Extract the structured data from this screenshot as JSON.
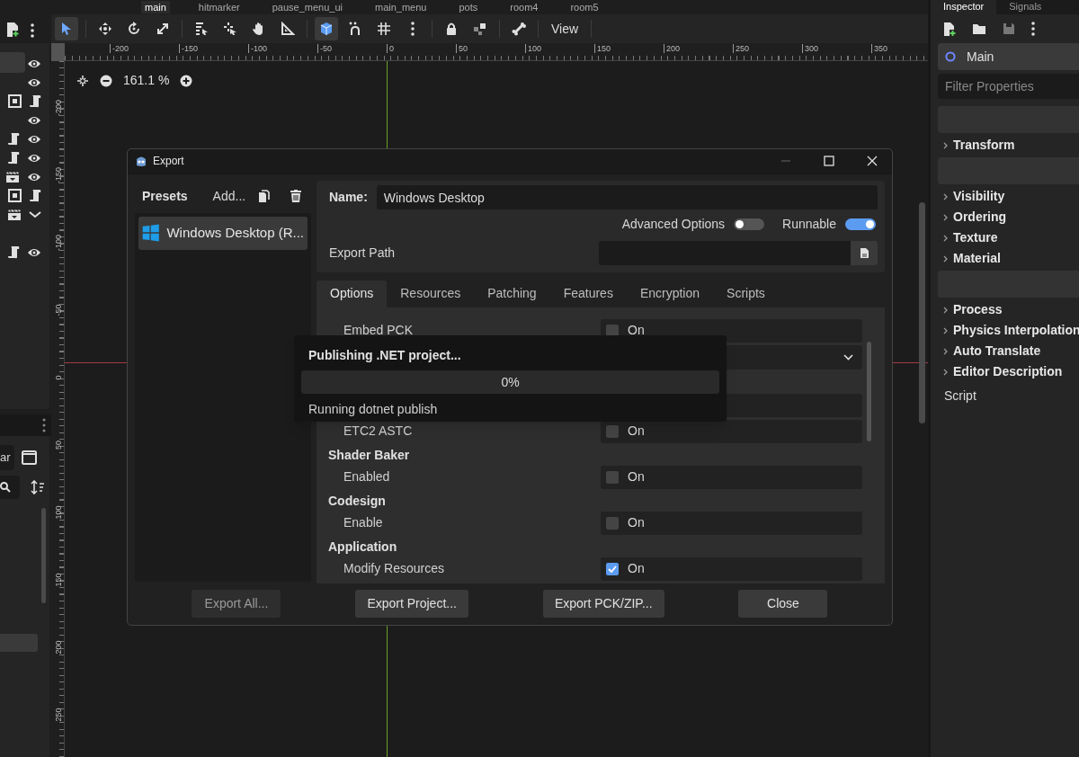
{
  "scene_tabs": [
    {
      "label": "main",
      "selected": true
    },
    {
      "label": "hitmarker",
      "selected": false
    },
    {
      "label": "pause_menu_ui",
      "selected": false
    },
    {
      "label": "main_menu",
      "selected": false
    },
    {
      "label": "pots",
      "selected": false
    },
    {
      "label": "room4",
      "selected": false
    },
    {
      "label": "room5",
      "selected": false
    }
  ],
  "toolbar": {
    "view_menu": "View"
  },
  "zoom": {
    "reading": "161.1 %"
  },
  "ruler": {
    "x_labels": [
      "-200",
      "-150",
      "-100",
      "-50",
      "0",
      "50",
      "100",
      "150",
      "200",
      "250",
      "300",
      "350"
    ],
    "y_labels": [
      "-200",
      "-150",
      "-100",
      "-50",
      "0",
      "50",
      "100",
      "150",
      "200",
      "250"
    ]
  },
  "filesystem": {
    "filter_value": "ar"
  },
  "inspector": {
    "tabs": [
      {
        "label": "Inspector",
        "selected": true
      },
      {
        "label": "Signals",
        "selected": false
      }
    ],
    "node": "Main",
    "filter_placeholder": "Filter Properties",
    "items": [
      {
        "kind": "category"
      },
      {
        "kind": "section",
        "label": "Transform"
      },
      {
        "kind": "category"
      },
      {
        "kind": "section",
        "label": "Visibility"
      },
      {
        "kind": "section",
        "label": "Ordering"
      },
      {
        "kind": "section",
        "label": "Texture"
      },
      {
        "kind": "section",
        "label": "Material"
      },
      {
        "kind": "category"
      },
      {
        "kind": "section",
        "label": "Process"
      },
      {
        "kind": "section",
        "label": "Physics Interpolation"
      },
      {
        "kind": "section",
        "label": "Auto Translate"
      },
      {
        "kind": "section",
        "label": "Editor Description"
      },
      {
        "kind": "plain",
        "label": "Script"
      }
    ]
  },
  "export_dialog": {
    "title": "Export",
    "presets_label": "Presets",
    "add_label": "Add...",
    "presets": [
      {
        "label": "Windows Desktop (R...",
        "selected": true
      }
    ],
    "name_label": "Name:",
    "name_value": "Windows Desktop",
    "advanced": {
      "label": "Advanced Options",
      "on": false
    },
    "runnable": {
      "label": "Runnable",
      "on": true
    },
    "export_path_label": "Export Path",
    "tabs": [
      {
        "label": "Options",
        "selected": true
      },
      {
        "label": "Resources",
        "selected": false
      },
      {
        "label": "Patching",
        "selected": false
      },
      {
        "label": "Features",
        "selected": false
      },
      {
        "label": "Encryption",
        "selected": false
      },
      {
        "label": "Scripts",
        "selected": false
      }
    ],
    "options": [
      {
        "kind": "check",
        "label": "Embed PCK",
        "checked": false,
        "value": "On"
      },
      {
        "kind": "dropdown"
      },
      {
        "kind": "field"
      },
      {
        "kind": "check",
        "label": "ETC2 ASTC",
        "checked": false,
        "value": "On"
      },
      {
        "kind": "heading",
        "label": "Shader Baker"
      },
      {
        "kind": "check",
        "label": "Enabled",
        "checked": false,
        "value": "On"
      },
      {
        "kind": "heading",
        "label": "Codesign"
      },
      {
        "kind": "check",
        "label": "Enable",
        "checked": false,
        "value": "On"
      },
      {
        "kind": "heading",
        "label": "Application"
      },
      {
        "kind": "check",
        "label": "Modify Resources",
        "checked": true,
        "value": "On"
      }
    ],
    "buttons": [
      {
        "label": "Export All...",
        "disabled": true
      },
      {
        "label": "Export Project...",
        "disabled": false
      },
      {
        "label": "Export PCK/ZIP...",
        "disabled": false
      },
      {
        "label": "Close",
        "disabled": false
      }
    ]
  },
  "progress": {
    "title": "Publishing .NET project...",
    "level": 0,
    "reading": "0%",
    "status": "Running dotnet publish"
  }
}
